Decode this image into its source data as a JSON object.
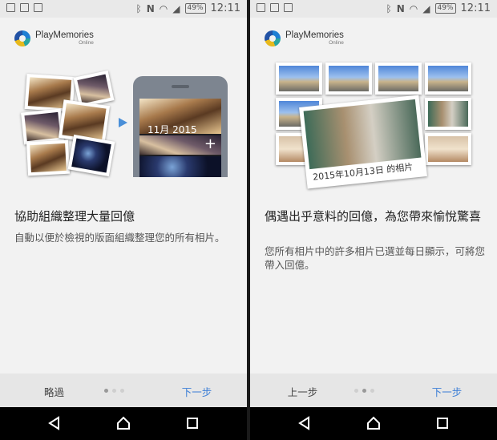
{
  "status_bar": {
    "battery": "49%",
    "time": "12:11"
  },
  "brand": {
    "name": "PlayMemories",
    "sub": "Online"
  },
  "left": {
    "phone_date": "11月 2015",
    "heading": "協助組織整理大量回億",
    "body": "自動以便於檢視的版面組織整理您的所有相片。",
    "skip_label": "略過",
    "next_label": "下一步"
  },
  "right": {
    "photo_caption": "2015年10月13日 的相片",
    "heading": "偶遇出乎意料的回億，為您帶來愉悅驚喜",
    "body": "您所有相片中的許多相片已選並每日顯示，可將您帶入回億。",
    "back_label": "上一步",
    "next_label": "下一步"
  },
  "icons": [
    "image-icon",
    "gallery-icon",
    "briefcase-icon",
    "bluetooth-icon",
    "nfc-icon",
    "wifi-icon",
    "signal-icon",
    "battery-icon",
    "back-icon",
    "home-icon",
    "recents-icon"
  ],
  "colors": {
    "accent": "#3d7fd6",
    "background": "#f2f2f2",
    "bottombar": "#e6e6e6"
  }
}
